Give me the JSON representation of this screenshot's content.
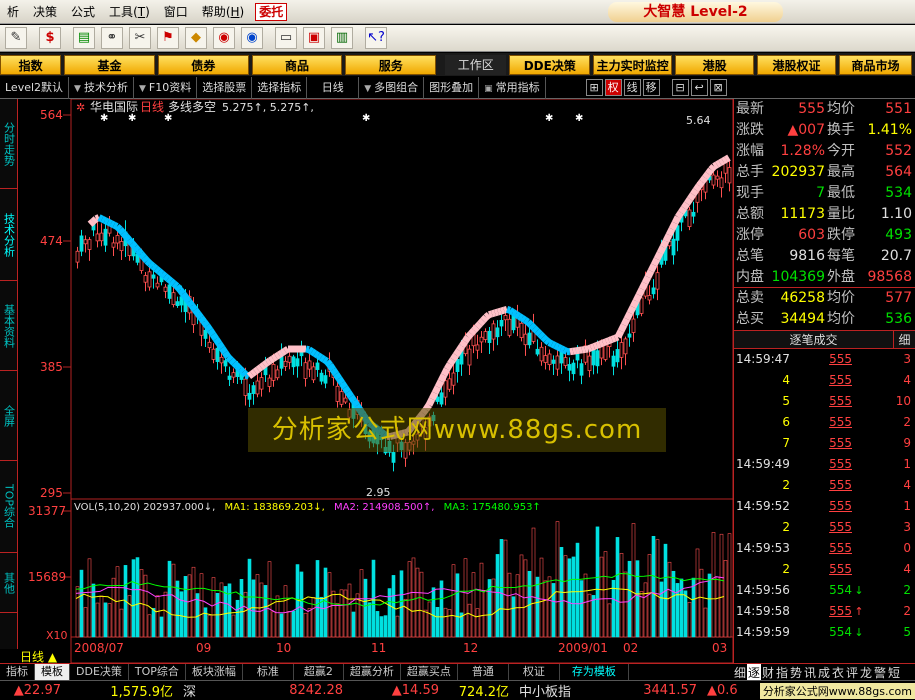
{
  "menu": {
    "items": [
      "析",
      "决策",
      "公式",
      "工具",
      "窗口",
      "帮助"
    ],
    "hotkeys": [
      "",
      "",
      "",
      "T",
      "",
      "H"
    ],
    "accent_item": "委托",
    "brand": "大智慧 Level-2"
  },
  "toolbar": {
    "icons": [
      "pen-icon",
      "dollar-icon",
      "money-icon",
      "binoculars-icon",
      "tools-icon",
      "flag-icon",
      "diamond-icon",
      "cd-icon",
      "disc-icon",
      "notepad-icon",
      "window-icon",
      "books-icon",
      "help-pointer-icon"
    ]
  },
  "navbar": {
    "buttons": [
      "指数",
      "基金",
      "债券",
      "商品",
      "服务"
    ],
    "workspace": "工作区",
    "right_buttons": [
      "DDE决策",
      "主力实时监控",
      "港股",
      "港股权证",
      "商品市场"
    ]
  },
  "funcbar": {
    "items": [
      "Level2默认",
      "技术分析",
      "F10资料",
      "选择股票",
      "选择指标",
      "日线",
      "多图组合",
      "图形叠加",
      "常用指标"
    ],
    "squares": [
      "权",
      "线",
      "移"
    ]
  },
  "left_tabs": [
    "分时走势",
    "技术分析",
    "基本资料",
    "全屏",
    "TOP综合",
    "其他"
  ],
  "chart": {
    "stock_name": "华电国际",
    "period": "日线",
    "indicator": "多线多空",
    "indicator_values": "5.275↑, 5.275↑,",
    "price_ticks": [
      "564",
      "474",
      "385",
      "295"
    ],
    "high_label": "5.64",
    "low_label": "2.95",
    "vol_legend": {
      "vol": "VOL(5,10,20) 202937.000↓,",
      "ma1": "MA1: 183869.203↓,",
      "ma2": "MA2: 214908.500↑,",
      "ma3": "MA3: 175480.953↑"
    },
    "vol_ticks": [
      "31377",
      "15689",
      "X10"
    ],
    "date_labels": [
      "2008/07",
      "09",
      "10",
      "11",
      "12",
      "2009/01",
      "02",
      "03"
    ],
    "period_label": "日线"
  },
  "watermark": "分析家公式网www.88gs.com",
  "bottom_tabs": [
    "指标",
    "模板",
    "DDE决策",
    "TOP综合",
    "板块涨幅",
    "标准",
    "超赢2",
    "超赢分析",
    "超赢买点",
    "普通",
    "权证",
    "存为模板"
  ],
  "quote": {
    "rows": [
      {
        "l1": "最新",
        "v1": "555",
        "c1": "red",
        "l2": "均价",
        "v2": "551",
        "c2": "red"
      },
      {
        "l1": "涨跌",
        "v1": "▲007",
        "c1": "red",
        "l2": "换手",
        "v2": "1.41%",
        "c2": "yellow"
      },
      {
        "l1": "涨幅",
        "v1": "1.28%",
        "c1": "red",
        "l2": "今开",
        "v2": "552",
        "c2": "red"
      },
      {
        "l1": "总手",
        "v1": "202937",
        "c1": "yellow",
        "l2": "最高",
        "v2": "564",
        "c2": "red"
      },
      {
        "l1": "现手",
        "v1": "7",
        "c1": "green",
        "l2": "最低",
        "v2": "534",
        "c2": "green"
      },
      {
        "l1": "总额",
        "v1": "11173",
        "c1": "yellow",
        "l2": "量比",
        "v2": "1.10",
        "c2": "white"
      },
      {
        "l1": "涨停",
        "v1": "603",
        "c1": "red",
        "l2": "跌停",
        "v2": "493",
        "c2": "green"
      },
      {
        "l1": "总笔",
        "v1": "9816",
        "c1": "white",
        "l2": "每笔",
        "v2": "20.7",
        "c2": "white"
      },
      {
        "l1": "内盘",
        "v1": "104369",
        "c1": "green",
        "l2": "外盘",
        "v2": "98568",
        "c2": "red"
      },
      {
        "l1": "总卖",
        "v1": "46258",
        "c1": "yellow",
        "l2": "均价",
        "v2": "577",
        "c2": "red"
      },
      {
        "l1": "总买",
        "v1": "34494",
        "c1": "yellow",
        "l2": "均价",
        "v2": "536",
        "c2": "green"
      }
    ],
    "tick_header": "逐笔成交",
    "tick_header_right": "细",
    "ticks": [
      {
        "t": "14:59:47",
        "v": "555",
        "m": "",
        "n": "3",
        "tc": "white",
        "vc": "red",
        "nc": "red"
      },
      {
        "t": "4",
        "v": "555",
        "m": "",
        "n": "4",
        "tc": "yellow",
        "vc": "red",
        "nc": "red"
      },
      {
        "t": "5",
        "v": "555",
        "m": "",
        "n": "10",
        "tc": "yellow",
        "vc": "red",
        "nc": "red"
      },
      {
        "t": "6",
        "v": "555",
        "m": "",
        "n": "2",
        "tc": "yellow",
        "vc": "red",
        "nc": "red"
      },
      {
        "t": "7",
        "v": "555",
        "m": "",
        "n": "9",
        "tc": "yellow",
        "vc": "red",
        "nc": "red"
      },
      {
        "t": "14:59:49",
        "v": "555",
        "m": "",
        "n": "1",
        "tc": "white",
        "vc": "red",
        "nc": "red"
      },
      {
        "t": "2",
        "v": "555",
        "m": "",
        "n": "4",
        "tc": "yellow",
        "vc": "red",
        "nc": "red"
      },
      {
        "t": "14:59:52",
        "v": "555",
        "m": "",
        "n": "1",
        "tc": "white",
        "vc": "red",
        "nc": "red"
      },
      {
        "t": "2",
        "v": "555",
        "m": "",
        "n": "3",
        "tc": "yellow",
        "vc": "red",
        "nc": "red"
      },
      {
        "t": "14:59:53",
        "v": "555",
        "m": "",
        "n": "0",
        "tc": "white",
        "vc": "red",
        "nc": "red"
      },
      {
        "t": "2",
        "v": "555",
        "m": "",
        "n": "4",
        "tc": "yellow",
        "vc": "red",
        "nc": "red"
      },
      {
        "t": "14:59:56",
        "v": "554",
        "m": "↓",
        "n": "2",
        "tc": "white",
        "vc": "green",
        "nc": "green"
      },
      {
        "t": "14:59:58",
        "v": "555",
        "m": "↑",
        "n": "2",
        "tc": "white",
        "vc": "red",
        "nc": "red"
      },
      {
        "t": "14:59:59",
        "v": "554",
        "m": "↓",
        "n": "5",
        "tc": "white",
        "vc": "green",
        "nc": "green"
      }
    ]
  },
  "right_tabs": [
    "细",
    "逐",
    "财",
    "指",
    "势",
    "讯",
    "成",
    "衣",
    "评",
    "龙",
    "警",
    "短"
  ],
  "status": {
    "items": [
      {
        "text": "▲22.97",
        "color": "#ff4040"
      },
      {
        "text": "1,575.9亿",
        "color": "#ffff00"
      },
      {
        "text": "深",
        "color": "#e0e0e0"
      },
      {
        "text": "8242.28",
        "color": "#ff4040"
      },
      {
        "text": "▲14.59",
        "color": "#ff4040"
      },
      {
        "text": "724.2亿",
        "color": "#ffff00"
      },
      {
        "text": "中小板指",
        "color": "#e0e0e0"
      },
      {
        "text": "3441.57",
        "color": "#ff4040"
      },
      {
        "text": "▲0.6",
        "color": "#ff4040"
      }
    ],
    "site": "分析家公式网www.88gs.com"
  },
  "colors": {
    "accent_red": "#ff4040",
    "down_green": "#00e000",
    "grid": "#b22222",
    "band_up": "#ffc0c8",
    "band_down": "#00c0ff"
  }
}
